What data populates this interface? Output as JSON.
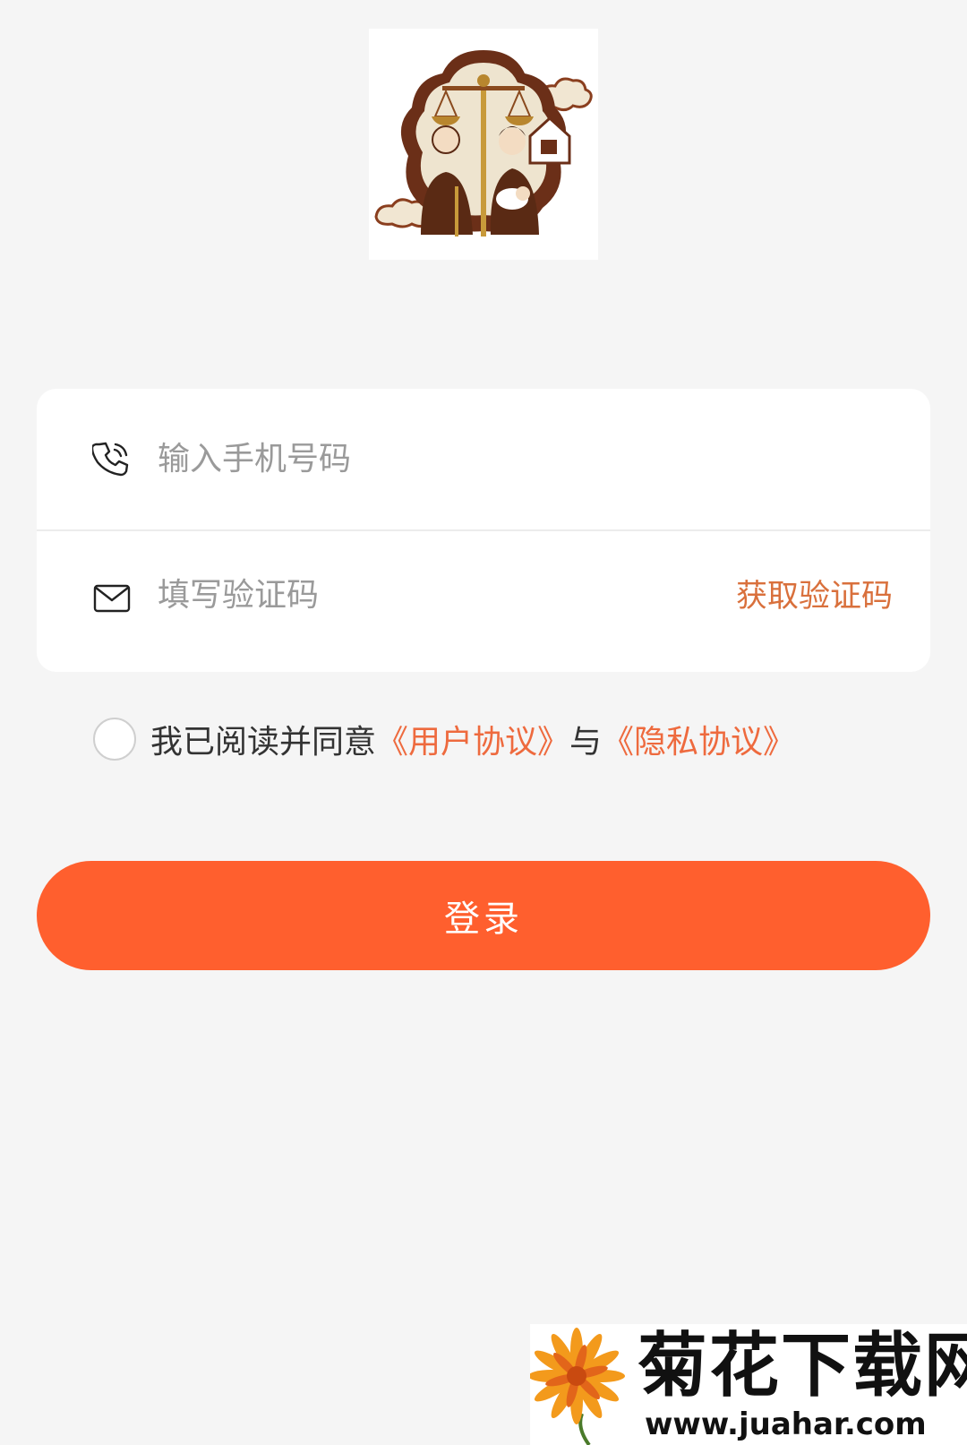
{
  "login": {
    "phone_placeholder": "输入手机号码",
    "code_placeholder": "填写验证码",
    "get_code_label": "获取验证码",
    "agree_prefix": "我已阅读并同意",
    "user_agreement": "《用户协议》",
    "agree_conjunction": "与",
    "privacy_agreement": "《隐私协议》",
    "login_label": "登录"
  },
  "watermark": {
    "title": "菊花下载网",
    "url": "www.juahar.com"
  },
  "icons": {
    "logo": "family-law-scales-logo",
    "phone": "phone-icon",
    "code": "mail-icon",
    "watermark": "chrysanthemum-icon"
  },
  "colors": {
    "background": "#f5f5f5",
    "primary": "#ff5f2e",
    "link": "#ee6a3e",
    "get_code": "#d9703c"
  }
}
